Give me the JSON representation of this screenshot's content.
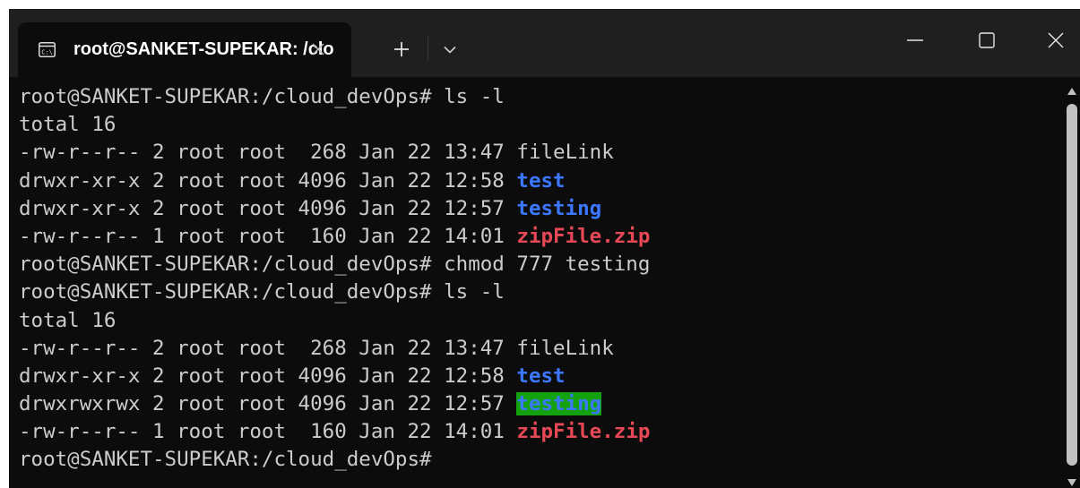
{
  "window": {
    "tab_title": "root@SANKET-SUPEKAR: /clo",
    "tab_icon": "terminal-icon",
    "icons": {
      "close_tab": "close-icon",
      "new_tab": "plus-icon",
      "dropdown": "chevron-down-icon",
      "minimize": "minimize-icon",
      "maximize": "maximize-icon",
      "close_window": "close-icon"
    }
  },
  "colors": {
    "background": "#0c0c0c",
    "titlebar": "#1f1f1f",
    "text": "#cccccc",
    "directory": "#3b78ff",
    "archive": "#e74856",
    "world_writable_bg": "#13a10e"
  },
  "terminal": {
    "lines": [
      [
        {
          "text": "root@SANKET-SUPEKAR:/cloud_devOps# ls -l",
          "style": "default"
        }
      ],
      [
        {
          "text": "total 16",
          "style": "default"
        }
      ],
      [
        {
          "text": "-rw-r--r-- 2 root root  268 Jan 22 13:47 ",
          "style": "default"
        },
        {
          "text": "fileLink",
          "style": "default"
        }
      ],
      [
        {
          "text": "drwxr-xr-x 2 root root 4096 Jan 22 12:58 ",
          "style": "default"
        },
        {
          "text": "test",
          "style": "dir"
        }
      ],
      [
        {
          "text": "drwxr-xr-x 2 root root 4096 Jan 22 12:57 ",
          "style": "default"
        },
        {
          "text": "testing",
          "style": "dir"
        }
      ],
      [
        {
          "text": "-rw-r--r-- 1 root root  160 Jan 22 14:01 ",
          "style": "default"
        },
        {
          "text": "zipFile.zip",
          "style": "zip"
        }
      ],
      [
        {
          "text": "root@SANKET-SUPEKAR:/cloud_devOps# chmod 777 testing",
          "style": "default"
        }
      ],
      [
        {
          "text": "root@SANKET-SUPEKAR:/cloud_devOps# ls -l",
          "style": "default"
        }
      ],
      [
        {
          "text": "total 16",
          "style": "default"
        }
      ],
      [
        {
          "text": "-rw-r--r-- 2 root root  268 Jan 22 13:47 ",
          "style": "default"
        },
        {
          "text": "fileLink",
          "style": "default"
        }
      ],
      [
        {
          "text": "drwxr-xr-x 2 root root 4096 Jan 22 12:58 ",
          "style": "default"
        },
        {
          "text": "test",
          "style": "dir"
        }
      ],
      [
        {
          "text": "drwxrwxrwx 2 root root 4096 Jan 22 12:57 ",
          "style": "default"
        },
        {
          "text": "testing",
          "style": "writable"
        }
      ],
      [
        {
          "text": "-rw-r--r-- 1 root root  160 Jan 22 14:01 ",
          "style": "default"
        },
        {
          "text": "zipFile.zip",
          "style": "zip"
        }
      ],
      [
        {
          "text": "root@SANKET-SUPEKAR:/cloud_devOps#",
          "style": "default"
        }
      ]
    ]
  }
}
